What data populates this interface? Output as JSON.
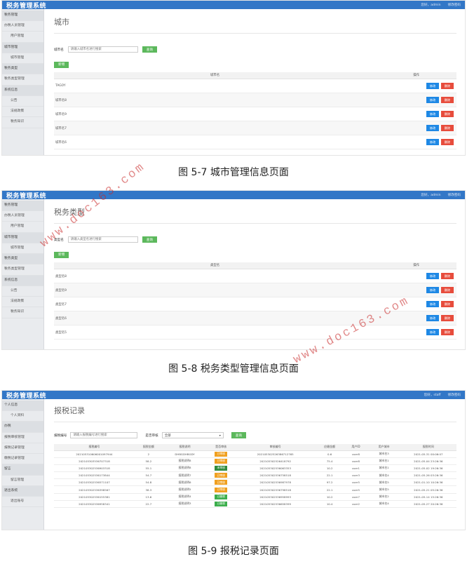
{
  "app_title": "税务管理系统",
  "admin_top": [
    "您好，admin",
    "修改密码"
  ],
  "staff_top": [
    "您好，staff",
    "修改密码"
  ],
  "admin_sidebar": [
    {
      "label": "税务管理",
      "group": true,
      "sub": false
    },
    {
      "label": "办税人员管理",
      "group": false,
      "sub": false
    },
    {
      "label": "用户管理",
      "group": false,
      "sub": true
    },
    {
      "label": "城市管理",
      "group": true,
      "sub": false
    },
    {
      "label": "城市管理",
      "group": false,
      "sub": true
    },
    {
      "label": "税务类型",
      "group": true,
      "sub": false
    },
    {
      "label": "税务类型管理",
      "group": false,
      "sub": false
    },
    {
      "label": "系统信息",
      "group": true,
      "sub": false
    },
    {
      "label": "公告",
      "group": false,
      "sub": true
    },
    {
      "label": "法规政策",
      "group": false,
      "sub": true
    },
    {
      "label": "税务知识",
      "group": false,
      "sub": true
    }
  ],
  "staff_sidebar": [
    {
      "label": "个人信息",
      "group": true,
      "sub": false
    },
    {
      "label": "个人资料",
      "group": false,
      "sub": true
    },
    {
      "label": "办税",
      "group": true,
      "sub": false
    },
    {
      "label": "报税审核管理",
      "group": false,
      "sub": false
    },
    {
      "label": "报税记录管理",
      "group": false,
      "sub": false
    },
    {
      "label": "缴税记录管理",
      "group": false,
      "sub": false
    },
    {
      "label": "留言",
      "group": true,
      "sub": false
    },
    {
      "label": "留言管理",
      "group": false,
      "sub": true
    },
    {
      "label": "退出系统",
      "group": true,
      "sub": false
    },
    {
      "label": "退出账号",
      "group": false,
      "sub": true
    }
  ],
  "panel1": {
    "page_title": "城市",
    "search_label": "城市名",
    "search_placeholder": "请输入城市名进行搜索",
    "search_btn": "查询",
    "add_btn": "新增",
    "col_name": "城市名",
    "col_action": "操作",
    "rows": [
      "TAGOY",
      "城市名8",
      "城市名9",
      "城市名7",
      "城市名6"
    ],
    "edit": "修改",
    "delete": "删除",
    "caption": "图 5-7 城市管理信息页面"
  },
  "panel2": {
    "page_title": "税务类型",
    "search_label": "类型名",
    "search_placeholder": "请输入类型名进行搜索",
    "search_btn": "查询",
    "add_btn": "新增",
    "col_name": "类型名",
    "col_action": "操作",
    "rows": [
      "类型名8",
      "类型名9",
      "类型名7",
      "类型名6",
      "类型名5"
    ],
    "edit": "修改",
    "delete": "删除",
    "caption": "图 5-8 税务类型管理信息页面"
  },
  "panel3": {
    "page_title": "报税记录",
    "search_label": "报税编号",
    "search_placeholder": "请输入报税编号进行搜索",
    "select_label": "是否审核",
    "select_value": "全部",
    "search_btn": "查询",
    "headers": [
      "报税编号",
      "报税金额",
      "报税说明",
      "是否审核",
      "审核编号",
      "应缴金额",
      "用户ID",
      "用户城市",
      "报税时间"
    ],
    "rows": [
      [
        "202105310606001097944",
        "2",
        "DHBGDHBGDY",
        "已审核",
        "202105302526386712765",
        "0.6",
        "user8",
        "城市名3",
        "2021-05-31 00:06:07"
      ],
      [
        "202105303536707318",
        "58.2",
        "报税说明8",
        "已审核",
        "202105302526418792",
        "75.4",
        "user8",
        "城市名1",
        "2021-05-04 23:26:36"
      ],
      [
        "202105302536903318",
        "55.1",
        "报税说明8",
        "未审核",
        "202105302536063353",
        "10.2",
        "user1",
        "城市名1",
        "2021-05-02 19:26:36"
      ],
      [
        "202105302536173844",
        "54.7",
        "报税说明7",
        "已审核",
        "202105302536758518",
        "22.1",
        "user3",
        "城市名4",
        "2021-05-26 03:26:36"
      ],
      [
        "202105302536571107",
        "54.8",
        "报税说明6",
        "已审核",
        "202105302536987978",
        "97.2",
        "user5",
        "城市名5",
        "2021-01-10 10:26:36"
      ],
      [
        "202105302536398567",
        "38.3",
        "报税说明5",
        "已审核",
        "202105302536798518",
        "22.1",
        "user5",
        "城市名5",
        "2021-05-21 05:26:36"
      ],
      [
        "202105302536155381",
        "13.6",
        "报税说明4",
        "已缴税",
        "202105302536958993",
        "10.2",
        "user7",
        "城市名2",
        "2021-05-14 15:26:36"
      ],
      [
        "202105302536958341",
        "22.7",
        "报税说明3",
        "已缴税",
        "202105302536658399",
        "10.4",
        "user2",
        "城市名4",
        "2021-05-27 20:26:36"
      ]
    ],
    "badge_colors": {
      "已审核": "#f0a020",
      "未审核": "#2e8b3e",
      "已缴税": "#3cae4c"
    },
    "caption": "图 5-9 报税记录页面"
  },
  "watermark": "www.doc163.com"
}
